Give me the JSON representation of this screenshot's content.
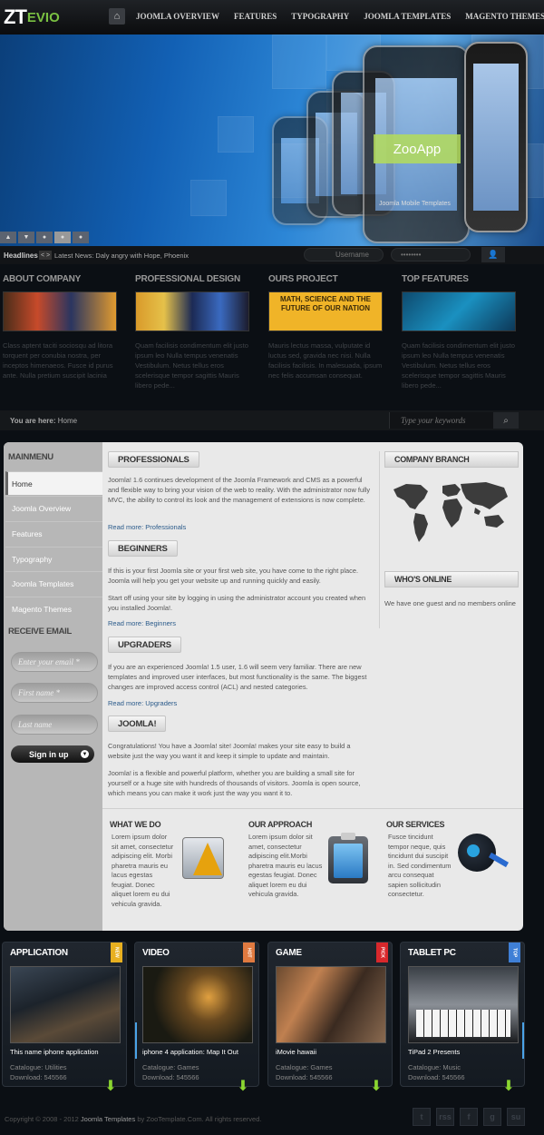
{
  "header": {
    "logo_main": "ZT",
    "logo_sub": "EVIO",
    "nav": [
      "JOOMLA OVERVIEW",
      "FEATURES",
      "TYPOGRAPHY",
      "JOOMLA TEMPLATES",
      "MAGENTO THEMES"
    ]
  },
  "banner": {
    "app_label": "ZooApp",
    "caption": "Joomla Mobile Templates",
    "slide_controls": [
      "▲",
      "▼",
      "●",
      "●",
      "●"
    ]
  },
  "headlines": {
    "label": "Headlines",
    "arrows": "< >",
    "news": "Latest News: Daly angry with Hope, Phoenix",
    "username_placeholder": "Username",
    "password_placeholder": "••••••••"
  },
  "features": [
    {
      "title": "ABOUT COMPANY",
      "text": "Class aptent taciti sociosqu ad litora torquent per conubia nostra, per inceptos himenaeos. Fusce id purus ante. Nulla pretium suscipit lacinia"
    },
    {
      "title": "PROFESSIONAL DESIGN",
      "text": "Quam facilisis condimentum elit justo ipsum leo Nulla tempus venenatis Vestibulum. Netus tellus eros scelerisque tempor sagittis Mauris libero pede..."
    },
    {
      "title": "OURS PROJECT",
      "text": "Mauris lectus massa, vulputate id luctus sed, gravida nec nisi. Nulla facilisis facilisis. In malesuada, ipsum nec felis accumsan consequat."
    },
    {
      "title": "TOP FEATURES",
      "text": "Quam facilisis condimentum elit justo ipsum leo Nulla tempus venenatis Vestibulum. Netus tellus eros scelerisque tempor sagittis Mauris libero pede..."
    }
  ],
  "feature_images": {
    "project_banner": "MATH, SCIENCE AND THE FUTURE OF OUR NATION"
  },
  "breadcrumb": {
    "label": "You are here:",
    "current": "Home",
    "search_placeholder": "Type your keywords"
  },
  "sidebar": {
    "menu_title": "MAINMENU",
    "items": [
      "Home",
      "Joomla Overview",
      "Features",
      "Typography",
      "Joomla Templates",
      "Magento Themes"
    ],
    "email_title": "RECEIVE EMAIL",
    "email_placeholder": "Enter your email *",
    "firstname_placeholder": "First name *",
    "lastname_placeholder": "Last name",
    "signup_label": "Sign in up"
  },
  "articles": [
    {
      "title": "PROFESSIONALS",
      "paragraphs": [
        "Joomla! 1.6 continues development of the Joomla Framework and CMS as a powerful and flexible way to bring your vision of the web to reality. With the administrator now fully MVC, the ability to control its look and the management of extensions is now complete."
      ],
      "readmore": "Read more: Professionals"
    },
    {
      "title": "BEGINNERS",
      "paragraphs": [
        "If this is your first Joomla site or your first web site, you have come to the right place. Joomla will help you get your website up and running quickly and easily.",
        "Start off using your site by logging in using the administrator account you created when you installed Joomla!."
      ],
      "readmore": "Read more: Beginners"
    },
    {
      "title": "UPGRADERS",
      "paragraphs": [
        "If you are an experienced Joomla! 1.5 user, 1.6 will seem very familiar. There are new templates and improved user interfaces, but most functionality is the same. The biggest changes are improved access control (ACL) and nested categories."
      ],
      "readmore": "Read more: Upgraders"
    },
    {
      "title": "JOOMLA!",
      "paragraphs": [
        "Congratulations! You have a Joomla! site! Joomla! makes your site easy to build a website just the way you want it and keep it simple to update and maintain.",
        "Joomla! is a flexible and powerful platform, whether you are building a small site for yourself or a huge site with hundreds of thousands of visitors. Joomla is open source, which means you can make it work just the way you want it to."
      ],
      "readmore": ""
    }
  ],
  "right": {
    "branch_title": "COMPANY BRANCH",
    "online_title": "WHO'S ONLINE",
    "online_text": "We have one guest and no members online"
  },
  "bottom_cells": [
    {
      "title": "WHAT WE DO",
      "text": "Lorem ipsum dolor sit amet, consectetur adipiscing elit. Morbi pharetra mauris eu lacus egestas feugiat. Donec aliquet lorem eu dui vehicula gravida."
    },
    {
      "title": "OUR APPROACH",
      "text": "Lorem ipsum dolor sit amet, consectetur adipiscing elit.Morbi pharetra mauris eu lacus egestas feugiat. Donec aliquet lorem eu dui vehicula gravida."
    },
    {
      "title": "OUR SERVICES",
      "text": "Fusce tincidunt tempor neque, quis tincidunt dui suscipit in. Sed condimentum arcu consequat sapien sollicitudin consectetur."
    }
  ],
  "products": [
    {
      "category": "APPLICATION",
      "ribbon": "NEW",
      "ribbon_color": "#e8b020",
      "title": "This name iphone application",
      "catalogue": "Catalogue: Utilities",
      "download": "Download: 545566"
    },
    {
      "category": "VIDEO",
      "ribbon": "HOT",
      "ribbon_color": "#e07a40",
      "title": "iphone 4 application: Map It Out",
      "catalogue": "Catalogue: Games",
      "download": "Download: 545566"
    },
    {
      "category": "GAME",
      "ribbon": "PICK",
      "ribbon_color": "#d8282c",
      "title": "iMovie hawaii",
      "catalogue": "Catalogue: Games",
      "download": "Download: 545566"
    },
    {
      "category": "TABLET PC",
      "ribbon": "TOP",
      "ribbon_color": "#3f7fd6",
      "title": "TiPad 2 Presents",
      "catalogue": "Catalogue: Music",
      "download": "Download: 545566"
    }
  ],
  "footer": {
    "copyright_pre": "Copyright © 2008 - 2012",
    "brand": "Joomla Templates",
    "copyright_post": "by ZooTemplate.Com. All rights reserved.",
    "social": [
      "t",
      "rss",
      "f",
      "g",
      "su"
    ]
  }
}
